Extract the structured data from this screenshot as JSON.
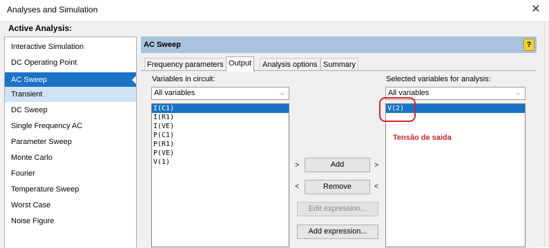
{
  "window": {
    "title": "Analyses and Simulation"
  },
  "active_label": "Active Analysis:",
  "analyses": [
    "Interactive Simulation",
    "DC Operating Point",
    "AC Sweep",
    "Transient",
    "DC Sweep",
    "Single Frequency AC",
    "Parameter Sweep",
    "Monte Carlo",
    "Fourier",
    "Temperature Sweep",
    "Worst Case",
    "Noise Figure"
  ],
  "selected_analysis": "AC Sweep",
  "section_title": "AC Sweep",
  "help": "?",
  "tabs": [
    "Frequency parameters",
    "Output",
    "Analysis options",
    "Summary"
  ],
  "active_tab": "Output",
  "output": {
    "circuit_label": "Variables in circuit:",
    "circuit_filter": "All variables",
    "circuit_vars": [
      "I(C1)",
      "I(R1)",
      "I(VE)",
      "P(C1)",
      "P(R1)",
      "P(VE)",
      "V(1)"
    ],
    "selected_label": "Selected variables for analysis:",
    "selected_filter": "All variables",
    "selected_vars": [
      "V(2)"
    ],
    "add_label": "Add",
    "remove_label": "Remove",
    "edit_expr_label": "Edit expression...",
    "add_expr_label": "Add expression...",
    "arrow_right": ">",
    "arrow_left": "<"
  },
  "annotation": "Tensão de saida",
  "colors": {
    "selection": "#1a73c7",
    "header": "#a9c2de",
    "annotation": "#c62828"
  }
}
